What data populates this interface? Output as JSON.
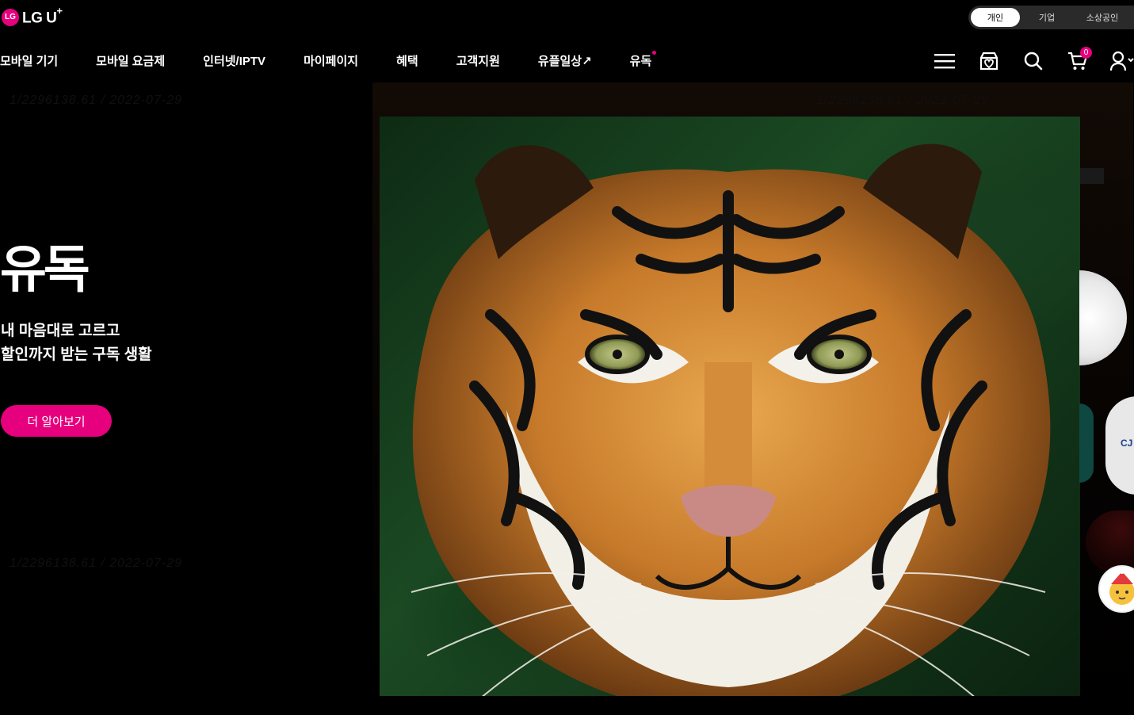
{
  "brand": {
    "logo_text": "LG U",
    "logo_sup": "+",
    "logo_mark": "LG"
  },
  "segment": {
    "items": [
      "개인",
      "기업",
      "소상공인"
    ],
    "active": "개인"
  },
  "nav": {
    "items": [
      "모바일 기기",
      "모바일 요금제",
      "인터넷/IPTV",
      "마이페이지",
      "혜택",
      "고객지원",
      "유플일상↗",
      "유독"
    ]
  },
  "utils": {
    "cart_count": "0"
  },
  "hero": {
    "title": "유독",
    "desc_line1": "내 마음대로 고르고",
    "desc_line2": "할인까지 받는 구독 생활",
    "cta": "더 알아보기",
    "ghost_date": "1/2296138.61 / 2022-07-29"
  },
  "side_cards": {
    "card3_text": "CJ"
  },
  "colors": {
    "accent": "#e6007e",
    "background": "#000000"
  },
  "icons": [
    "menu-icon",
    "store-icon",
    "search-icon",
    "cart-icon",
    "user-icon"
  ]
}
